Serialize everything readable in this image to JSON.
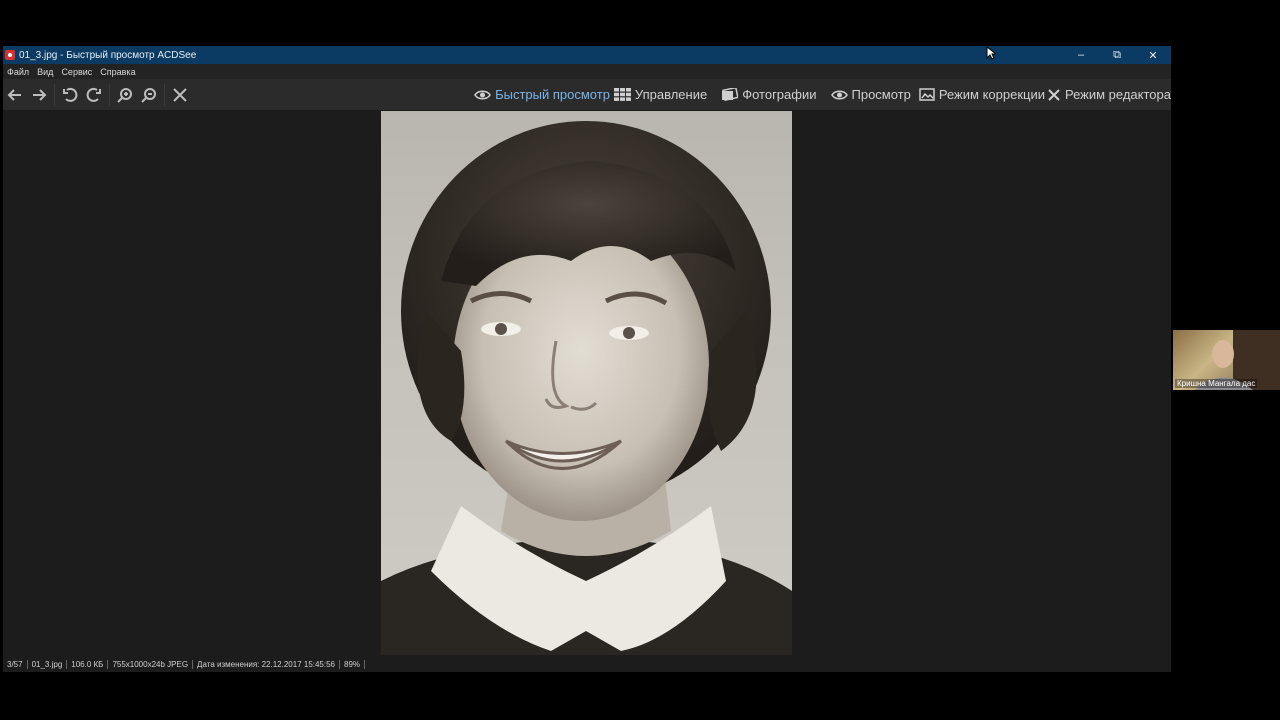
{
  "window": {
    "title": "01_3.jpg - Быстрый просмотр ACDSee",
    "minimize": "–",
    "maximize": "⧉",
    "close": "✕"
  },
  "menu": [
    "Файл",
    "Вид",
    "Сервис",
    "Справка"
  ],
  "toolbar": {
    "icons": [
      "back-arrow-icon",
      "forward-arrow-icon",
      "rotate-left-icon",
      "rotate-right-icon",
      "zoom-in-icon",
      "zoom-out-icon",
      "close-x-icon"
    ]
  },
  "modes": [
    {
      "label": "Быстрый просмотр",
      "icon": "eye-icon",
      "active": true
    },
    {
      "label": "Управление",
      "icon": "grid-icon",
      "active": false
    },
    {
      "label": "Фотографии",
      "icon": "photos-icon",
      "active": false
    },
    {
      "label": "Просмотр",
      "icon": "eye-icon",
      "active": false
    },
    {
      "label": "Режим коррекции",
      "icon": "develop-icon",
      "active": false
    },
    {
      "label": "Режим редактора",
      "icon": "edit-icon",
      "active": false
    }
  ],
  "status": {
    "index": "3/57",
    "filename": "01_3.jpg",
    "size": "106.0 КБ",
    "dimensions": "755x1000x24b JPEG",
    "modified": "Дата изменения: 22.12.2017 15:45:56",
    "zoom": "89%"
  },
  "webcam": {
    "name": "Кришна Мангала дас"
  },
  "colors": {
    "titlebar": "#0b3a63",
    "active_mode": "#7ab4ea"
  }
}
